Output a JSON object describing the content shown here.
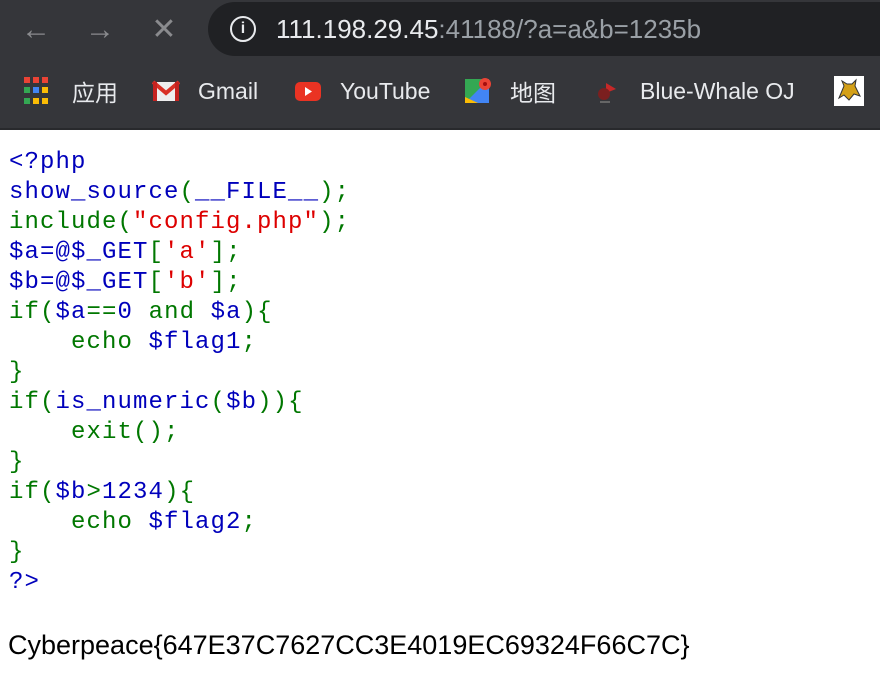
{
  "browser": {
    "url_host": "111.198.29.45",
    "url_rest": ":41188/?a=a&b=1235b",
    "nav": {
      "back_icon": "arrow-left-icon",
      "forward_icon": "arrow-right-icon",
      "stop_icon": "close-icon"
    },
    "bookmarks": [
      {
        "label": "应用",
        "icon": "apps-grid-icon"
      },
      {
        "label": "Gmail",
        "icon": "gmail-icon"
      },
      {
        "label": "YouTube",
        "icon": "youtube-icon"
      },
      {
        "label": "地图",
        "icon": "maps-icon"
      },
      {
        "label": "Blue-Whale OJ",
        "icon": "blue-whale-icon"
      },
      {
        "label": "",
        "icon": "tomcat-icon"
      }
    ]
  },
  "colors": {
    "keyword": "#007700",
    "default": "#0000BB",
    "string": "#DD0000"
  },
  "code_lines": [
    [
      [
        "<?php",
        "d"
      ]
    ],
    [
      [
        "show_source",
        "d"
      ],
      [
        "(",
        "k"
      ],
      [
        "__FILE__",
        "d"
      ],
      [
        ");",
        "k"
      ]
    ],
    [
      [
        "include(",
        "k"
      ],
      [
        "\"config.php\"",
        "s"
      ],
      [
        ");",
        "k"
      ]
    ],
    [
      [
        "$a=@$_GET",
        "d"
      ],
      [
        "[",
        "k"
      ],
      [
        "'a'",
        "s"
      ],
      [
        "];",
        "k"
      ]
    ],
    [
      [
        "$b=@$_GET",
        "d"
      ],
      [
        "[",
        "k"
      ],
      [
        "'b'",
        "s"
      ],
      [
        "];",
        "k"
      ]
    ],
    [
      [
        "if(",
        "k"
      ],
      [
        "$a",
        "d"
      ],
      [
        "==",
        "k"
      ],
      [
        "0 ",
        "d"
      ],
      [
        "and ",
        "k"
      ],
      [
        "$a",
        "d"
      ],
      [
        "){",
        "k"
      ]
    ],
    [
      [
        "    echo ",
        "k"
      ],
      [
        "$flag1",
        "d"
      ],
      [
        ";",
        "k"
      ]
    ],
    [
      [
        "}",
        "k"
      ]
    ],
    [
      [
        "if(",
        "k"
      ],
      [
        "is_numeric",
        "d"
      ],
      [
        "(",
        "k"
      ],
      [
        "$b",
        "d"
      ],
      [
        ")){",
        "k"
      ]
    ],
    [
      [
        "    exit();",
        "k"
      ]
    ],
    [
      [
        "}",
        "k"
      ]
    ],
    [
      [
        "if(",
        "k"
      ],
      [
        "$b",
        "d"
      ],
      [
        ">",
        "k"
      ],
      [
        "1234",
        "d"
      ],
      [
        "){",
        "k"
      ]
    ],
    [
      [
        "    echo ",
        "k"
      ],
      [
        "$flag2",
        "d"
      ],
      [
        ";",
        "k"
      ]
    ],
    [
      [
        "}",
        "k"
      ]
    ],
    [
      [
        "?>",
        "d"
      ]
    ]
  ],
  "output": "Cyberpeace{647E37C7627CC3E4019EC69324F66C7C}"
}
